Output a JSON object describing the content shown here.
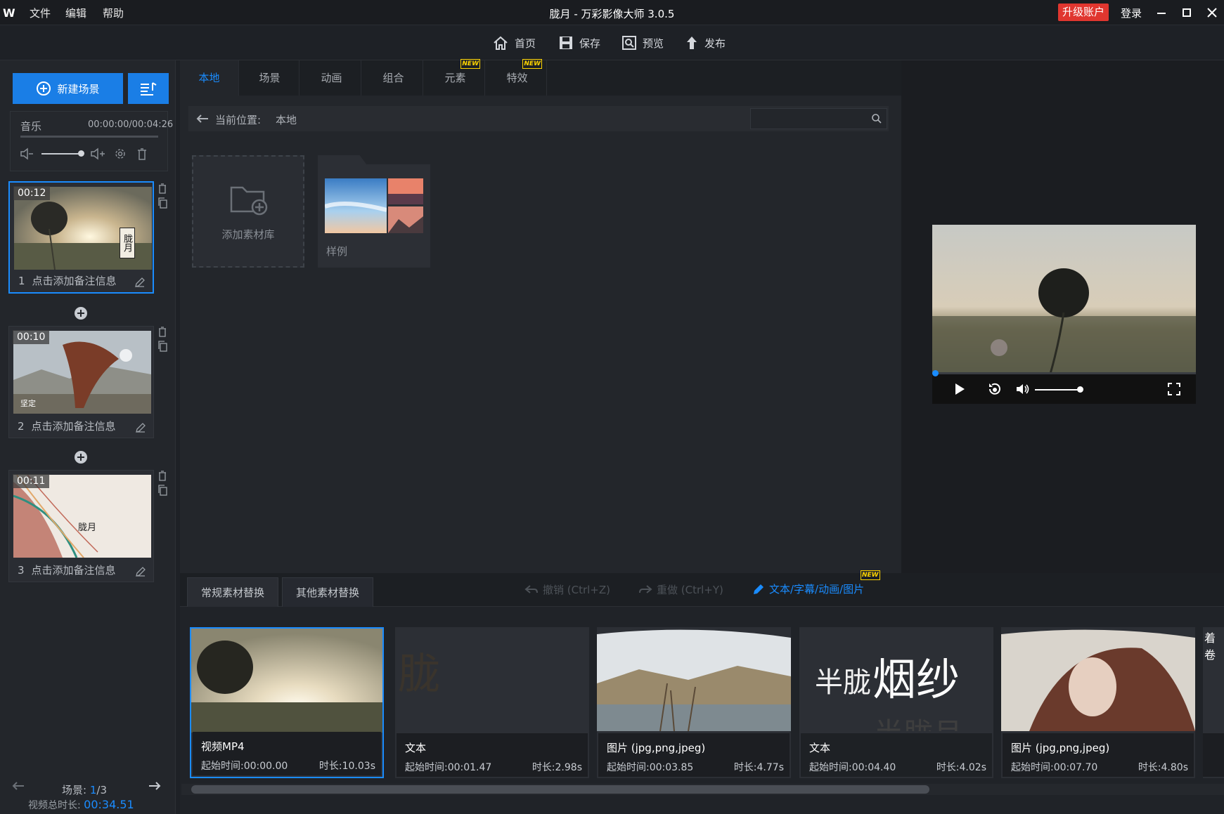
{
  "window": {
    "logo": "W",
    "title": "胧月 - 万彩影像大师 3.0.5",
    "menu": [
      "文件",
      "编辑",
      "帮助"
    ],
    "upgrade_label": "升级账户",
    "login_label": "登录"
  },
  "toolbar": {
    "home": "首页",
    "save": "保存",
    "preview": "预览",
    "publish": "发布"
  },
  "left": {
    "new_scene": "新建场景",
    "music_label": "音乐",
    "music_time": "00:00:00/00:04:26",
    "scenes": [
      {
        "index": "1",
        "duration": "00:12",
        "note": "点击添加备注信息",
        "thumb_text": "胧月"
      },
      {
        "index": "2",
        "duration": "00:10",
        "note": "点击添加备注信息",
        "thumb_text": "坚定"
      },
      {
        "index": "3",
        "duration": "00:11",
        "note": "点击添加备注信息",
        "thumb_text": "胧月"
      }
    ],
    "scene_counter_label": "场景:",
    "scene_current": "1",
    "scene_total": "/3",
    "total_duration_label": "视频总时长:",
    "total_duration": "00:34.51"
  },
  "library": {
    "tabs": [
      {
        "label": "本地",
        "new": false
      },
      {
        "label": "场景",
        "new": false
      },
      {
        "label": "动画",
        "new": false
      },
      {
        "label": "组合",
        "new": false
      },
      {
        "label": "元素",
        "new": true
      },
      {
        "label": "特效",
        "new": true
      }
    ],
    "new_badge": "NEW",
    "path_label": "当前位置:",
    "path_value": "本地",
    "search_placeholder": "",
    "add_library": "添加素材库",
    "sample_folder": "样例"
  },
  "bottom": {
    "tab_regular": "常规素材替换",
    "tab_other": "其他素材替换",
    "undo": "撤销 (Ctrl+Z)",
    "redo": "重做 (Ctrl+Y)",
    "edit_link": "文本/字幕/动画/图片",
    "clips": [
      {
        "type": "视频MP4",
        "start": "起始时间:00:00.00",
        "duration": "时长:10.03s"
      },
      {
        "type": "文本",
        "start": "起始时间:00:01.47",
        "duration": "时长:2.98s",
        "overlay": "胧"
      },
      {
        "type": "图片 (jpg,png,jpeg)",
        "start": "起始时间:00:03.85",
        "duration": "时长:4.77s"
      },
      {
        "type": "文本",
        "start": "起始时间:00:04.40",
        "duration": "时长:4.02s",
        "overlay1": "半胧",
        "overlay2": "烟纱",
        "overlay3": "半胧月"
      },
      {
        "type": "图片 (jpg,png,jpeg)",
        "start": "起始时间:00:07.70",
        "duration": "时长:4.80s"
      }
    ],
    "partial_clip_text": "着卷"
  },
  "preview": {
    "progress": 0.0,
    "volume": 0.85
  }
}
